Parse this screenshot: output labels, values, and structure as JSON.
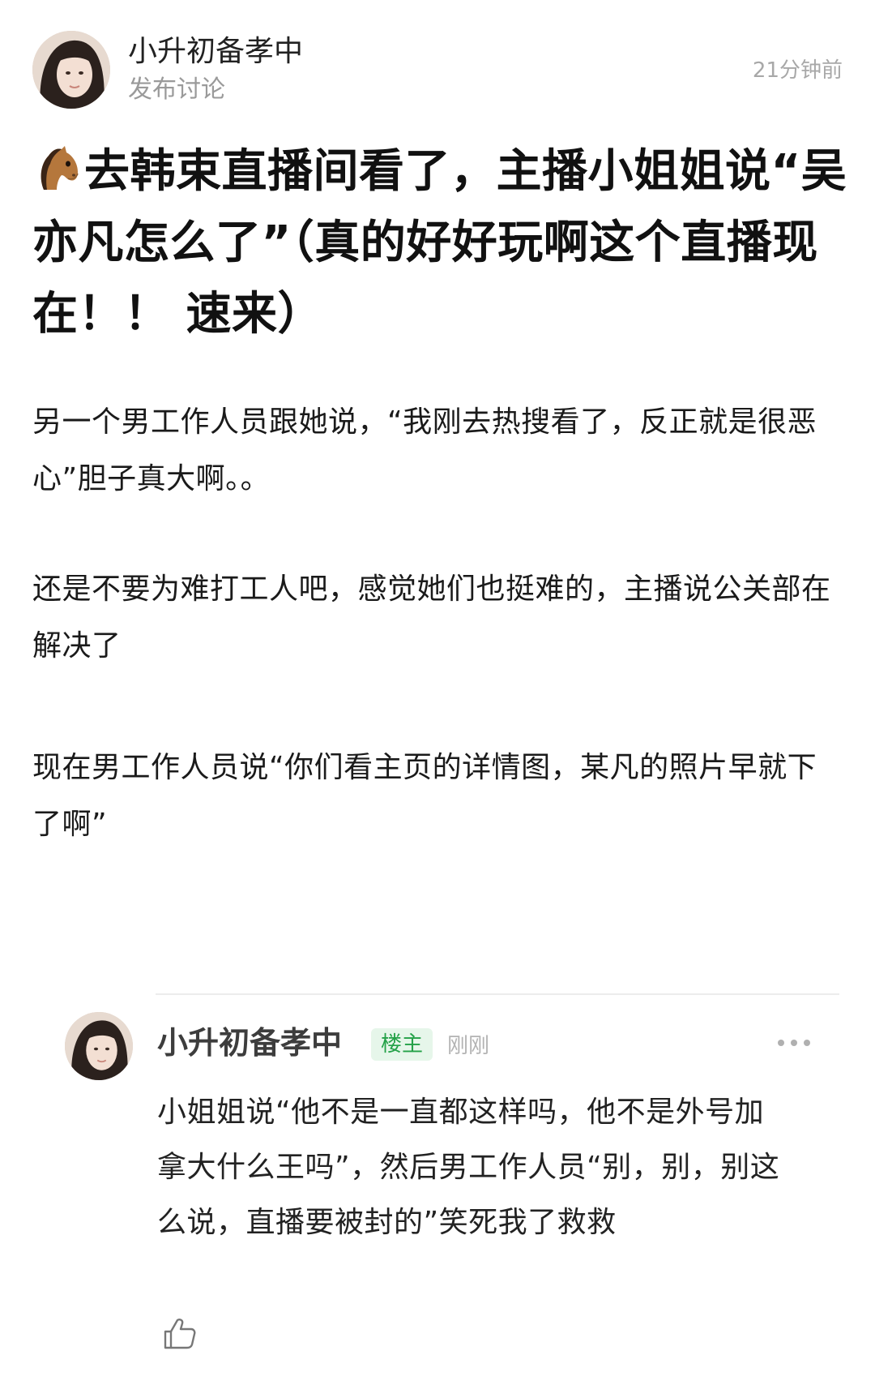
{
  "post": {
    "author": "小升初备孝中",
    "subtitle": "发布讨论",
    "time": "21分钟前",
    "title_icon": "horse-face-emoji",
    "title": "去韩束直播间看了，主播小姐姐说“吴亦凡怎么了”（真的好好玩啊这个直播现在！！ 速来）",
    "paragraphs": [
      "另一个男工作人员跟她说，“我刚去热搜看了，反正就是很恶心”胆子真大啊。。",
      "还是不要为难打工人吧，感觉她们也挺难的，主播说公关部在解决了",
      "现在男工作人员说“你们看主页的详情图，某凡的照片早就下了啊”"
    ]
  },
  "reply": {
    "author": "小升初备孝中",
    "badge": "楼主",
    "time": "刚刚",
    "text": "小姐姐说“他不是一直都这样吗，他不是外号加拿大什么王吗”，然后男工作人员“别，别，别这么说，直播要被封的”笑死我了救救",
    "more_icon": "more-dots-icon",
    "like_icon": "thumbs-up-icon"
  },
  "colors": {
    "badge_text": "#24a148",
    "badge_bg": "#e6f6ea",
    "muted_text": "#a8a8a8"
  }
}
